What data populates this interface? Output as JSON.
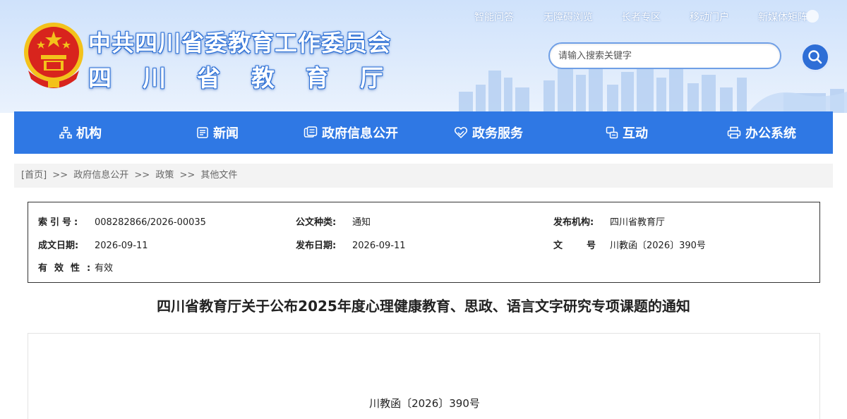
{
  "header": {
    "title_line1": "中共四川省委教育工作委员会",
    "title_line2": "四川省教育厅",
    "top_links": [
      "智能问答",
      "无障碍浏览",
      "长者专区",
      "移动门户",
      "新媒体矩阵"
    ],
    "search_placeholder": "请输入搜索关键字"
  },
  "nav": {
    "items": [
      {
        "label": "机构",
        "icon": "org-icon"
      },
      {
        "label": "新闻",
        "icon": "news-icon"
      },
      {
        "label": "政府信息公开",
        "icon": "info-open-icon"
      },
      {
        "label": "政务服务",
        "icon": "service-icon"
      },
      {
        "label": "互动",
        "icon": "interact-icon"
      },
      {
        "label": "办公系统",
        "icon": "printer-icon"
      }
    ]
  },
  "breadcrumb": {
    "items": [
      "[首页]",
      "政府信息公开",
      "政策",
      "其他文件"
    ],
    "separator": ">>"
  },
  "meta": {
    "index_label": "索引号:",
    "index_value": "008282866/2026-00035",
    "type_label": "公文种类:",
    "type_value": "通知",
    "publisher_label": "发布机构:",
    "publisher_value": "四川省教育厅",
    "created_label": "成文日期:",
    "created_value": "2026-09-11",
    "published_label": "发布日期:",
    "published_value": "2026-09-11",
    "docno_label": "文号:",
    "docno_value": "川教函〔2026〕390号",
    "validity_label": "有效性:",
    "validity_value": "有效"
  },
  "document": {
    "title": "四川省教育厅关于公布2025年度心理健康教育、思政、语言文字研究专项课题的通知",
    "number": "川教函〔2026〕390号"
  },
  "colors": {
    "nav_bg": "#2f78e4",
    "header_bg": "#d6e6fb",
    "search_btn": "#2e6ed6"
  }
}
